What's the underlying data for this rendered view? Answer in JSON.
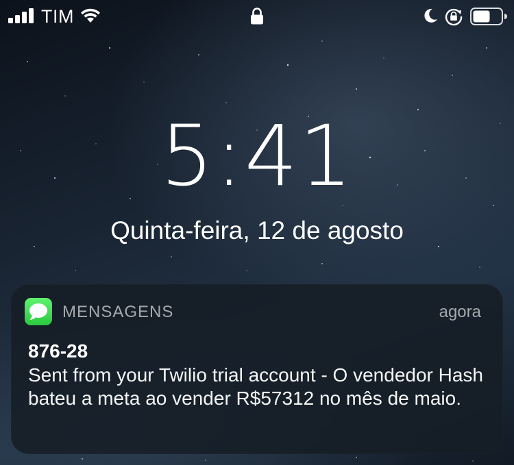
{
  "status_bar": {
    "carrier": "TIM",
    "signal_bars": 4,
    "icons": [
      "signal-icon",
      "wifi-icon",
      "lock-icon",
      "do-not-disturb-moon-icon",
      "rotation-lock-icon",
      "battery-icon"
    ]
  },
  "lock_screen": {
    "time": "5:41",
    "date": "Quinta-feira, 12 de agosto"
  },
  "notification": {
    "app_name": "MENSAGENS",
    "timestamp": "agora",
    "sender": "876-28",
    "message": "Sent from your Twilio trial account - O vendedor Hash bateu a meta ao vender R$57312 no mês de maio.",
    "app_icon": "messages-icon",
    "app_icon_color": "#34c759"
  }
}
